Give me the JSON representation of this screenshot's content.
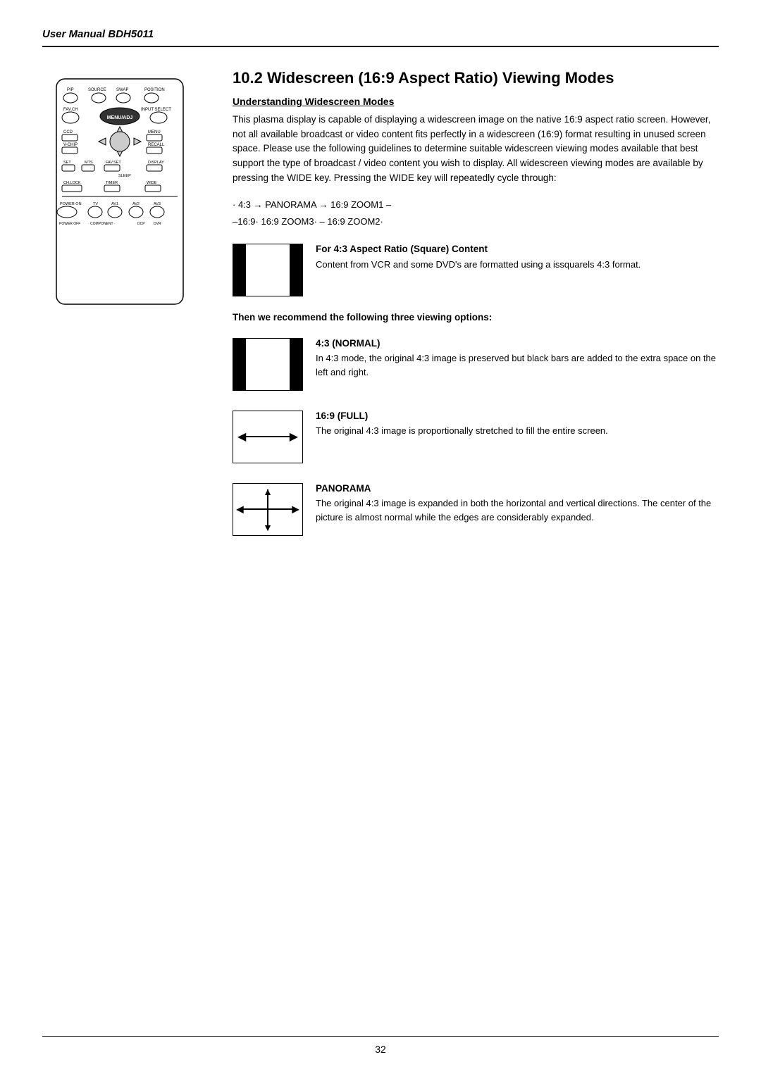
{
  "header": {
    "title": "User Manual BDH5011"
  },
  "section": {
    "number": "10.2",
    "title": "Widescreen (16:9 Aspect Ratio) Viewing Modes",
    "subtitle": "Understanding Widescreen Modes",
    "intro_text": "This plasma display is capable of displaying a widescreen image on the native 16:9 aspect ratio screen. However, not all available broadcast or video content fits perfectly in a widescreen (16:9) format resulting in unused screen space. Please use the following guidelines to determine suitable widescreen viewing modes available that best support the type of broadcast / video content you wish to display. All widescreen viewing modes are available by pressing the WIDE key. Pressing the WIDE key will repeatedly cycle through:",
    "zoom_cycle_line1": "· 4:3 → PANORAMA → 16:9 ZOOM1 –",
    "zoom_cycle_line2": "–16:9· 16:9 ZOOM3· – 16:9 ZOOM2·",
    "for43_label": "For 4:3 Aspect Ratio (Square) Content",
    "for43_desc": "Content from VCR and some DVD's are formatted using a issquarels 4:3 format.",
    "recommend_text": "Then we recommend the following three viewing options:",
    "modes": [
      {
        "id": "normal",
        "label": "4:3 (NORMAL)",
        "desc": "In 4:3 mode, the original 4:3 image is preserved but black bars are added to the extra space on the left and right.",
        "diagram": "43normal"
      },
      {
        "id": "full",
        "label": "16:9 (FULL)",
        "desc": "The original 4:3 image is proportionally stretched to fill the entire screen.",
        "diagram": "169full"
      },
      {
        "id": "panorama",
        "label": "PANORAMA",
        "desc": "The original 4:3 image is expanded in both the horizontal and vertical directions. The center of the picture is almost normal while the edges are considerably expanded.",
        "diagram": "panorama"
      }
    ]
  },
  "footer": {
    "page_number": "32"
  }
}
